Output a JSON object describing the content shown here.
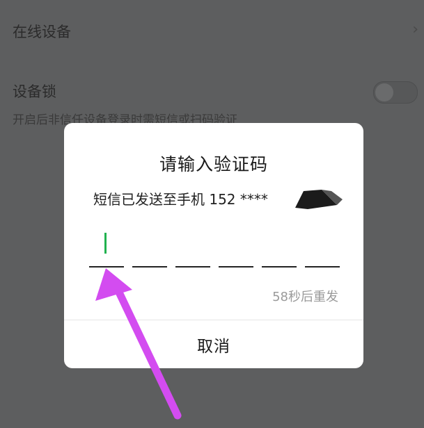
{
  "background": {
    "online_devices_label": "在线设备",
    "chevron_glyph": "›",
    "device_lock_label": "设备锁",
    "device_lock_desc": "开启后非信任设备登录时需短信或扫码验证",
    "device_lock_on": false
  },
  "dialog": {
    "title": "请输入验证码",
    "subtitle": "短信已发送至手机 152 ****",
    "code_length": 6,
    "resend_text": "58秒后重发",
    "cancel_label": "取消"
  },
  "colors": {
    "overlay": "#5d5e5f",
    "cursor": "#21b24f",
    "annotation_arrow": "#d34cf0"
  }
}
